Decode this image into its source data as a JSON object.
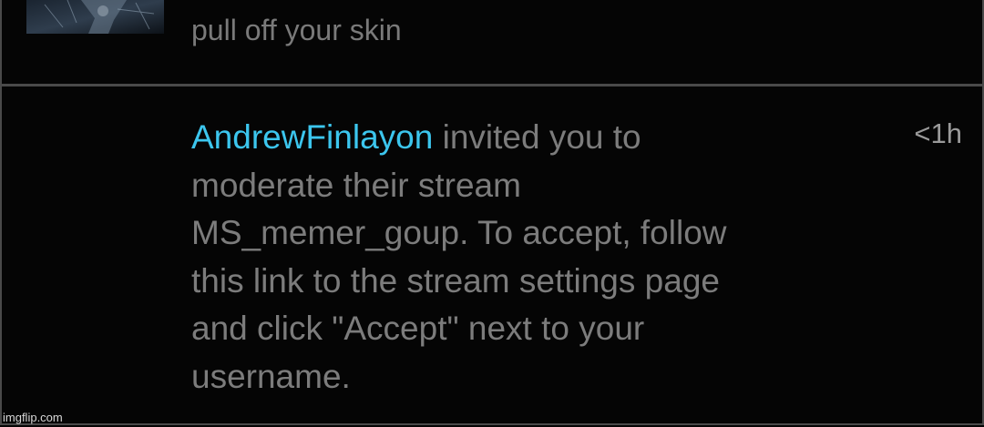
{
  "notifications": [
    {
      "thumbnail_icon": "stream-thumbnail-image",
      "text": "pull off your skin"
    },
    {
      "username": "AndrewFinlayon",
      "message_lines": [
        " invited you to",
        "moderate their stream",
        "MS_memer_goup. To accept, follow",
        "this link to the stream settings page",
        "and click \"Accept\" next to your",
        "username."
      ],
      "timestamp": "<1h"
    }
  ],
  "watermark": "imgflip.com",
  "colors": {
    "background": "#050505",
    "text": "#7c7c7c",
    "username": "#3cc6ee",
    "timestamp": "#9a9a9a",
    "border": "#4a4a4a"
  }
}
